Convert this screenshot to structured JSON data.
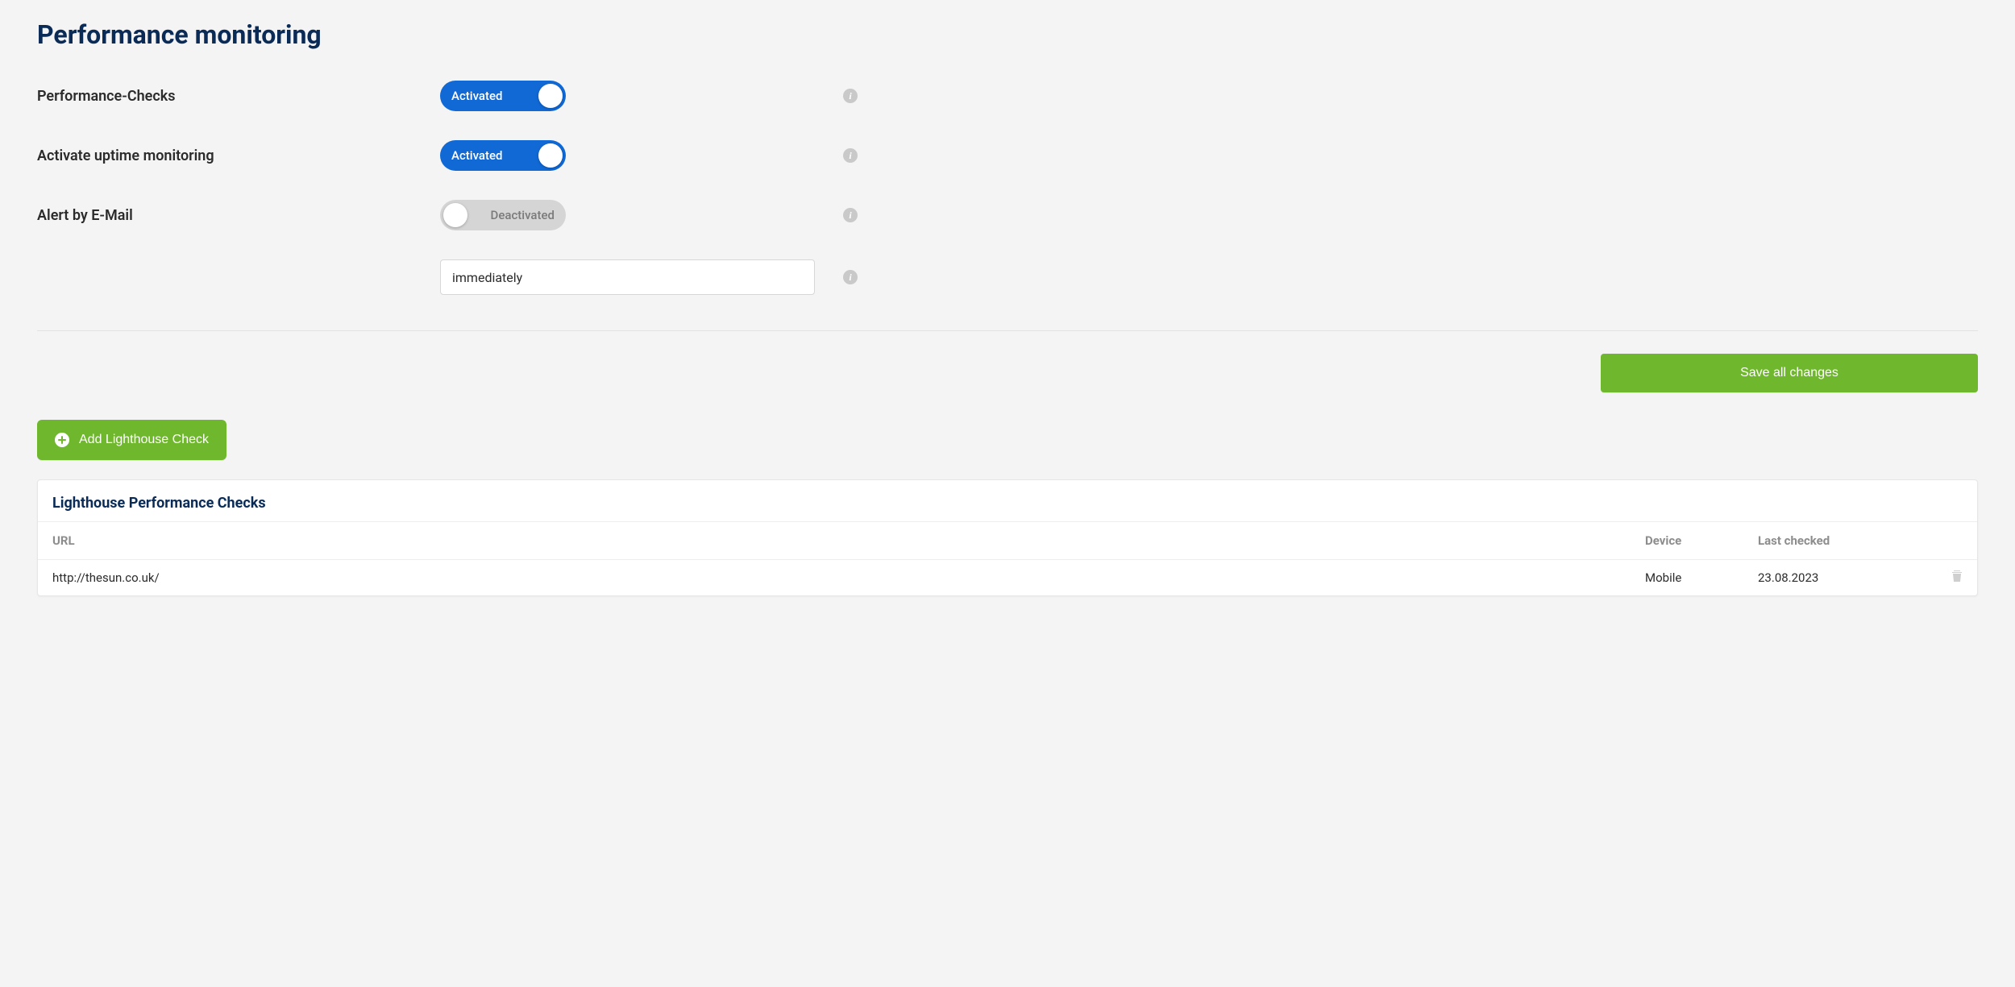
{
  "page": {
    "title": "Performance monitoring"
  },
  "settings": {
    "performance_checks": {
      "label": "Performance-Checks",
      "state_text": "Activated",
      "on": true
    },
    "uptime_monitoring": {
      "label": "Activate uptime monitoring",
      "state_text": "Activated",
      "on": true
    },
    "alert_email": {
      "label": "Alert by E-Mail",
      "state_text": "Deactivated",
      "on": false
    },
    "alert_interval": {
      "value": "immediately"
    }
  },
  "buttons": {
    "save": "Save all changes",
    "add_check": "Add Lighthouse Check"
  },
  "checks_card": {
    "title": "Lighthouse Performance Checks",
    "columns": {
      "url": "URL",
      "device": "Device",
      "last_checked": "Last checked"
    },
    "rows": [
      {
        "url": "http://thesun.co.uk/",
        "device": "Mobile",
        "last_checked": "23.08.2023"
      }
    ]
  }
}
